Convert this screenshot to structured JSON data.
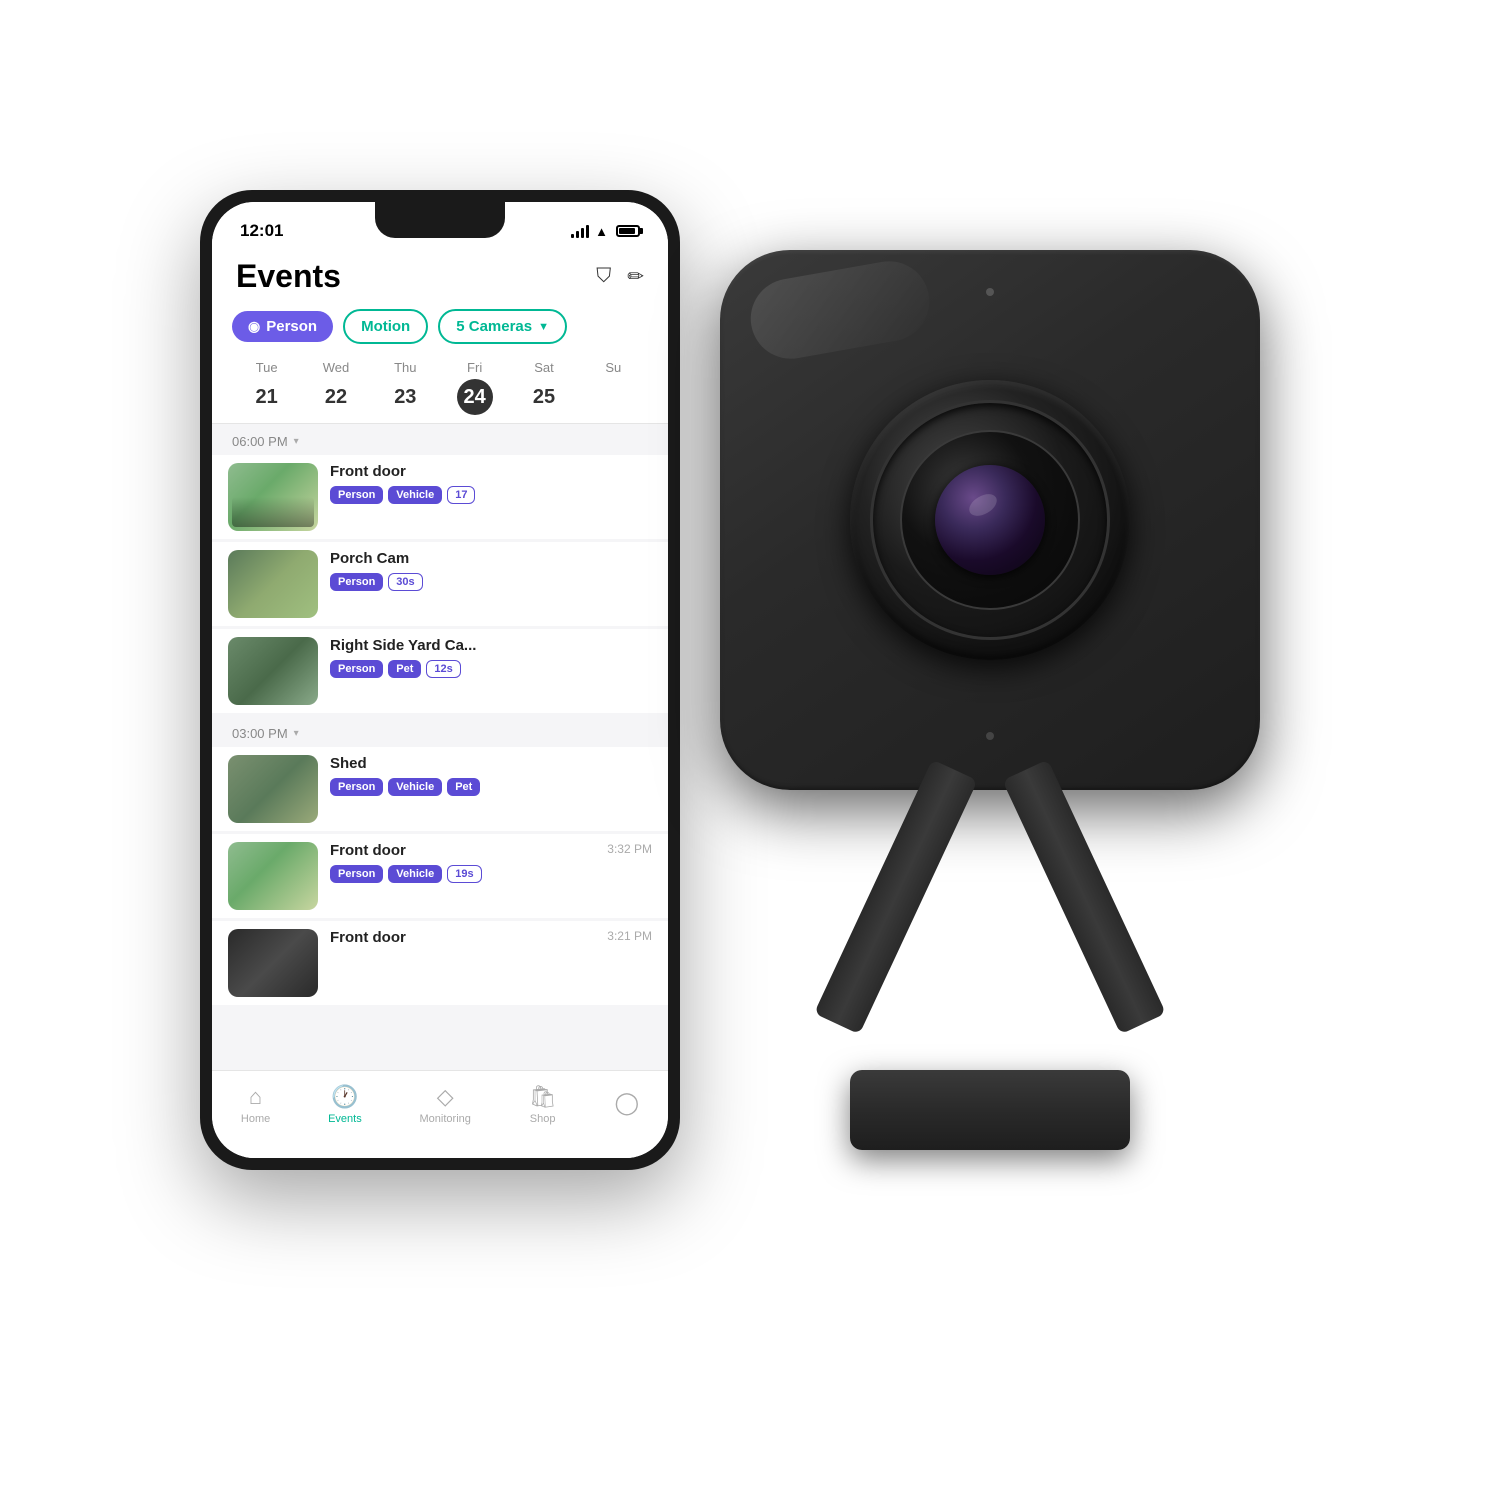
{
  "phone": {
    "status": {
      "time": "12:01"
    },
    "header": {
      "title": "Events",
      "filter_icon": "⛉",
      "edit_icon": "✏"
    },
    "filters": {
      "person_label": "Person",
      "motion_label": "Motion",
      "cameras_label": "5 Cameras"
    },
    "calendar": {
      "days": [
        {
          "label": "Tue",
          "num": "21"
        },
        {
          "label": "Wed",
          "num": "22"
        },
        {
          "label": "Thu",
          "num": "23"
        },
        {
          "label": "Fri",
          "num": "24",
          "selected": true
        },
        {
          "label": "Sat",
          "num": "25"
        },
        {
          "label": "Su",
          "num": ""
        }
      ]
    },
    "time_groups": [
      {
        "time": "06:00 PM",
        "events": [
          {
            "name": "Front door",
            "tags": [
              "Person",
              "Vehicle",
              "17"
            ],
            "thumb_class": "thumb-1"
          },
          {
            "name": "Porch Cam",
            "tags": [
              "Person",
              "30s"
            ],
            "thumb_class": "thumb-2"
          },
          {
            "name": "Right Side Yard Ca...",
            "tags": [
              "Person",
              "Pet",
              "12s"
            ],
            "thumb_class": "thumb-3"
          }
        ]
      },
      {
        "time": "03:00 PM",
        "events": [
          {
            "name": "Shed",
            "tags": [
              "Person",
              "Vehicle",
              "Pet"
            ],
            "thumb_class": "thumb-4"
          },
          {
            "name": "Front door",
            "tags": [
              "Person",
              "Vehicle",
              "19s"
            ],
            "timestamp": "3:32 PM",
            "thumb_class": "thumb-5"
          },
          {
            "name": "Front door",
            "timestamp": "3:21 PM",
            "tags": [],
            "thumb_class": "thumb-6"
          }
        ]
      }
    ],
    "nav": [
      {
        "label": "Home",
        "icon": "⌂",
        "active": false
      },
      {
        "label": "Events",
        "icon": "🕐",
        "active": true
      },
      {
        "label": "Monitoring",
        "icon": "◇",
        "active": false
      },
      {
        "label": "Shop",
        "icon": "🛍",
        "active": false
      },
      {
        "label": "",
        "icon": "◯",
        "active": false
      }
    ]
  }
}
